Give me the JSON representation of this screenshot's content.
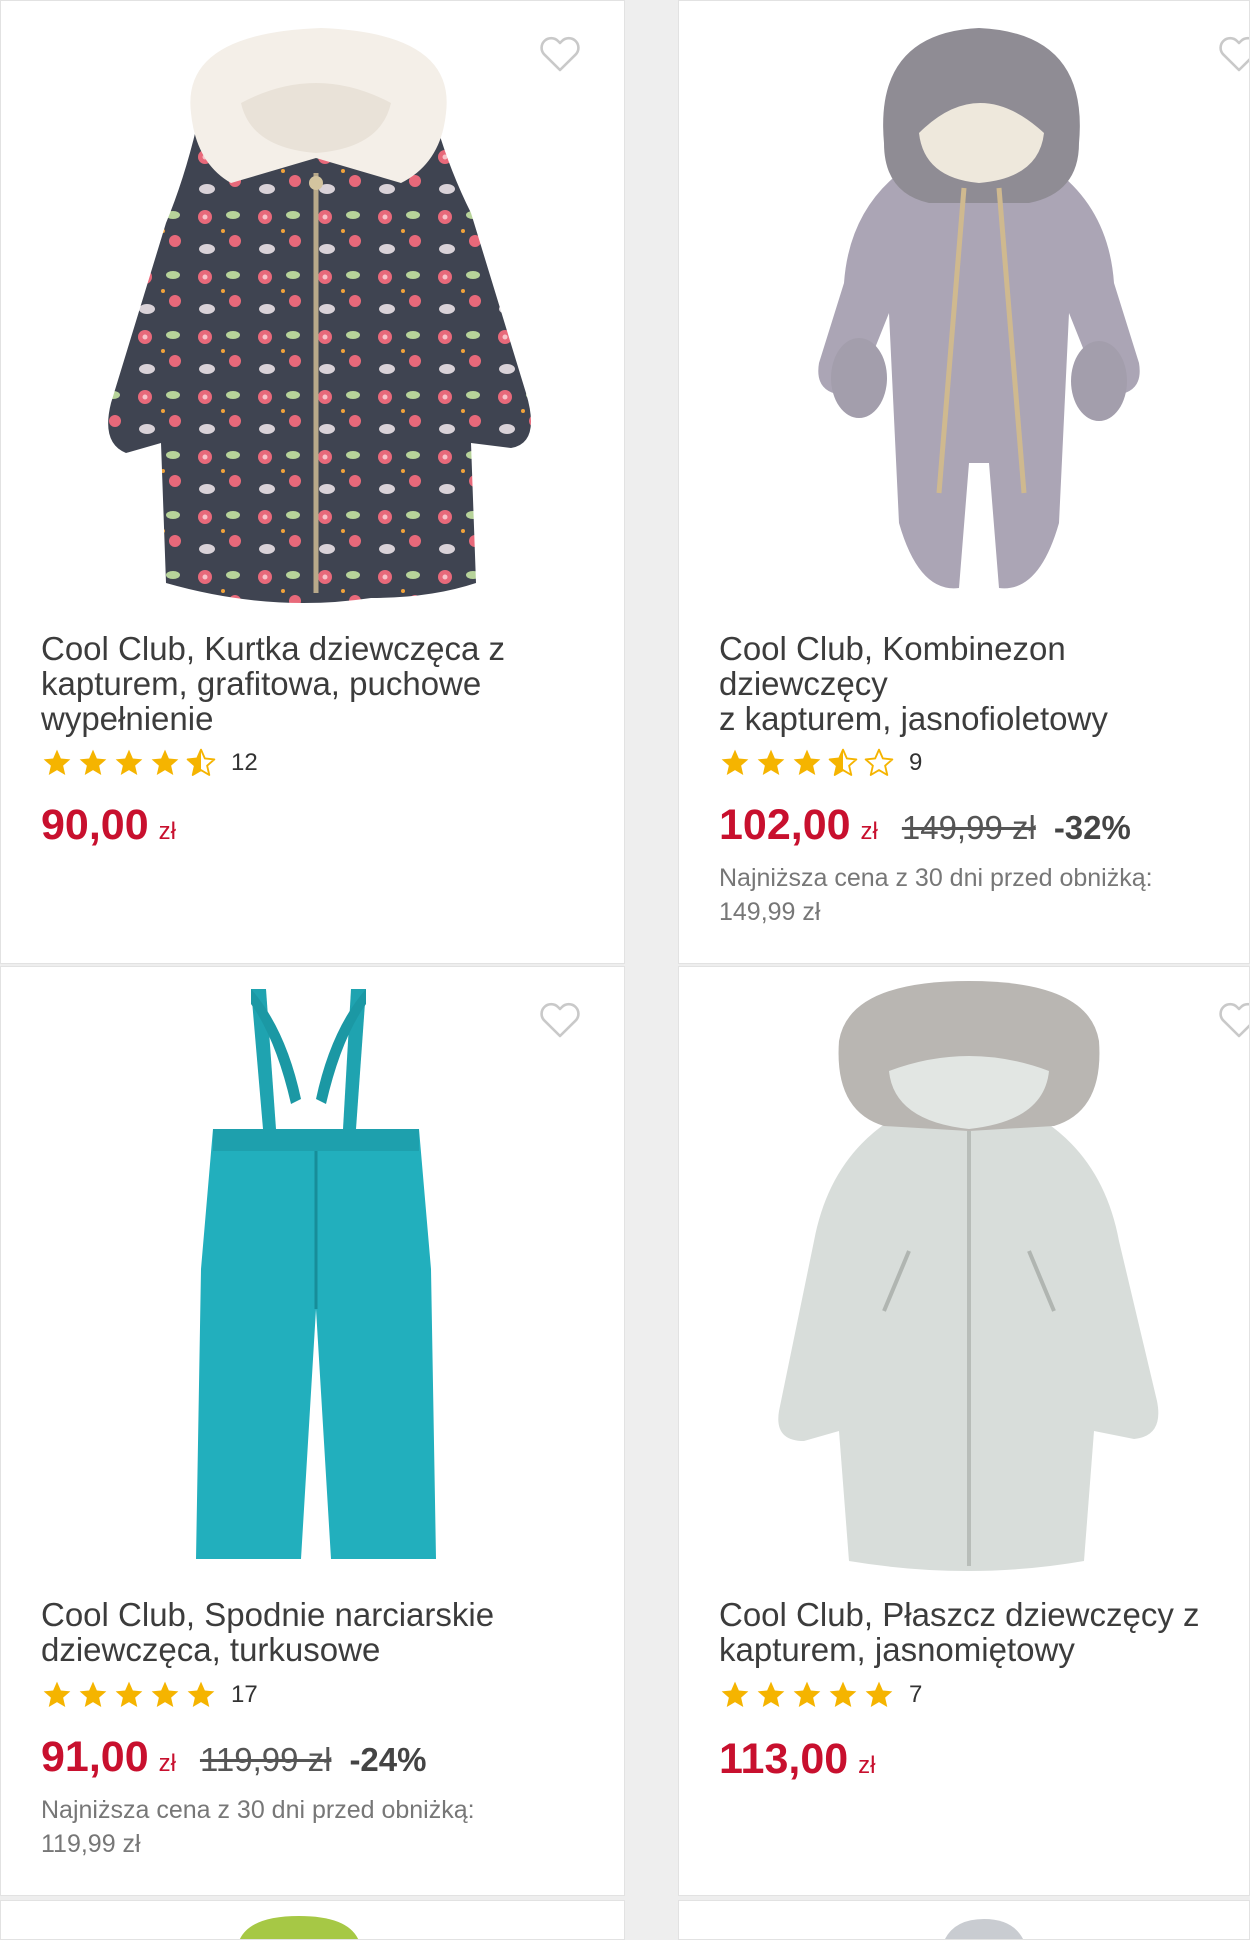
{
  "products": [
    {
      "title": "Cool Club, Kurtka dziewczęca z\nkapturem, grafitowa, puchowe\nwypełnienie",
      "rating_stars": 4.5,
      "reviews": "12",
      "price": "90,00",
      "currency": "zł",
      "image_icon": "floral-jacket-image"
    },
    {
      "title": "Cool Club, Kombinezon dziewczęcy\nz kapturem, jasnofioletowy",
      "rating_stars": 3.5,
      "reviews": "9",
      "price": "102,00",
      "currency": "zł",
      "old_price": "149,99 zł",
      "discount": "-32%",
      "lowest_label": "Najniższa cena z 30 dni przed obniżką:",
      "lowest_value": "149,99 zł",
      "image_icon": "snowsuit-image"
    },
    {
      "title": "Cool Club, Spodnie narciarskie\ndziewczęca, turkusowe",
      "rating_stars": 5,
      "reviews": "17",
      "price": "91,00",
      "currency": "zł",
      "old_price": "119,99 zł",
      "discount": "-24%",
      "lowest_label": "Najniższa cena z 30 dni przed obniżką:",
      "lowest_value": "119,99 zł",
      "image_icon": "ski-pants-image"
    },
    {
      "title": "Cool Club, Płaszcz dziewczęcy z\nkapturem, jasnomiętowy",
      "rating_stars": 5,
      "reviews": "7",
      "price": "113,00",
      "currency": "zł",
      "image_icon": "mint-coat-image"
    }
  ],
  "colors": {
    "price_red": "#c8102e",
    "star_yellow": "#f5b400",
    "text_dark": "#3c3c3c",
    "text_muted": "#777777"
  }
}
